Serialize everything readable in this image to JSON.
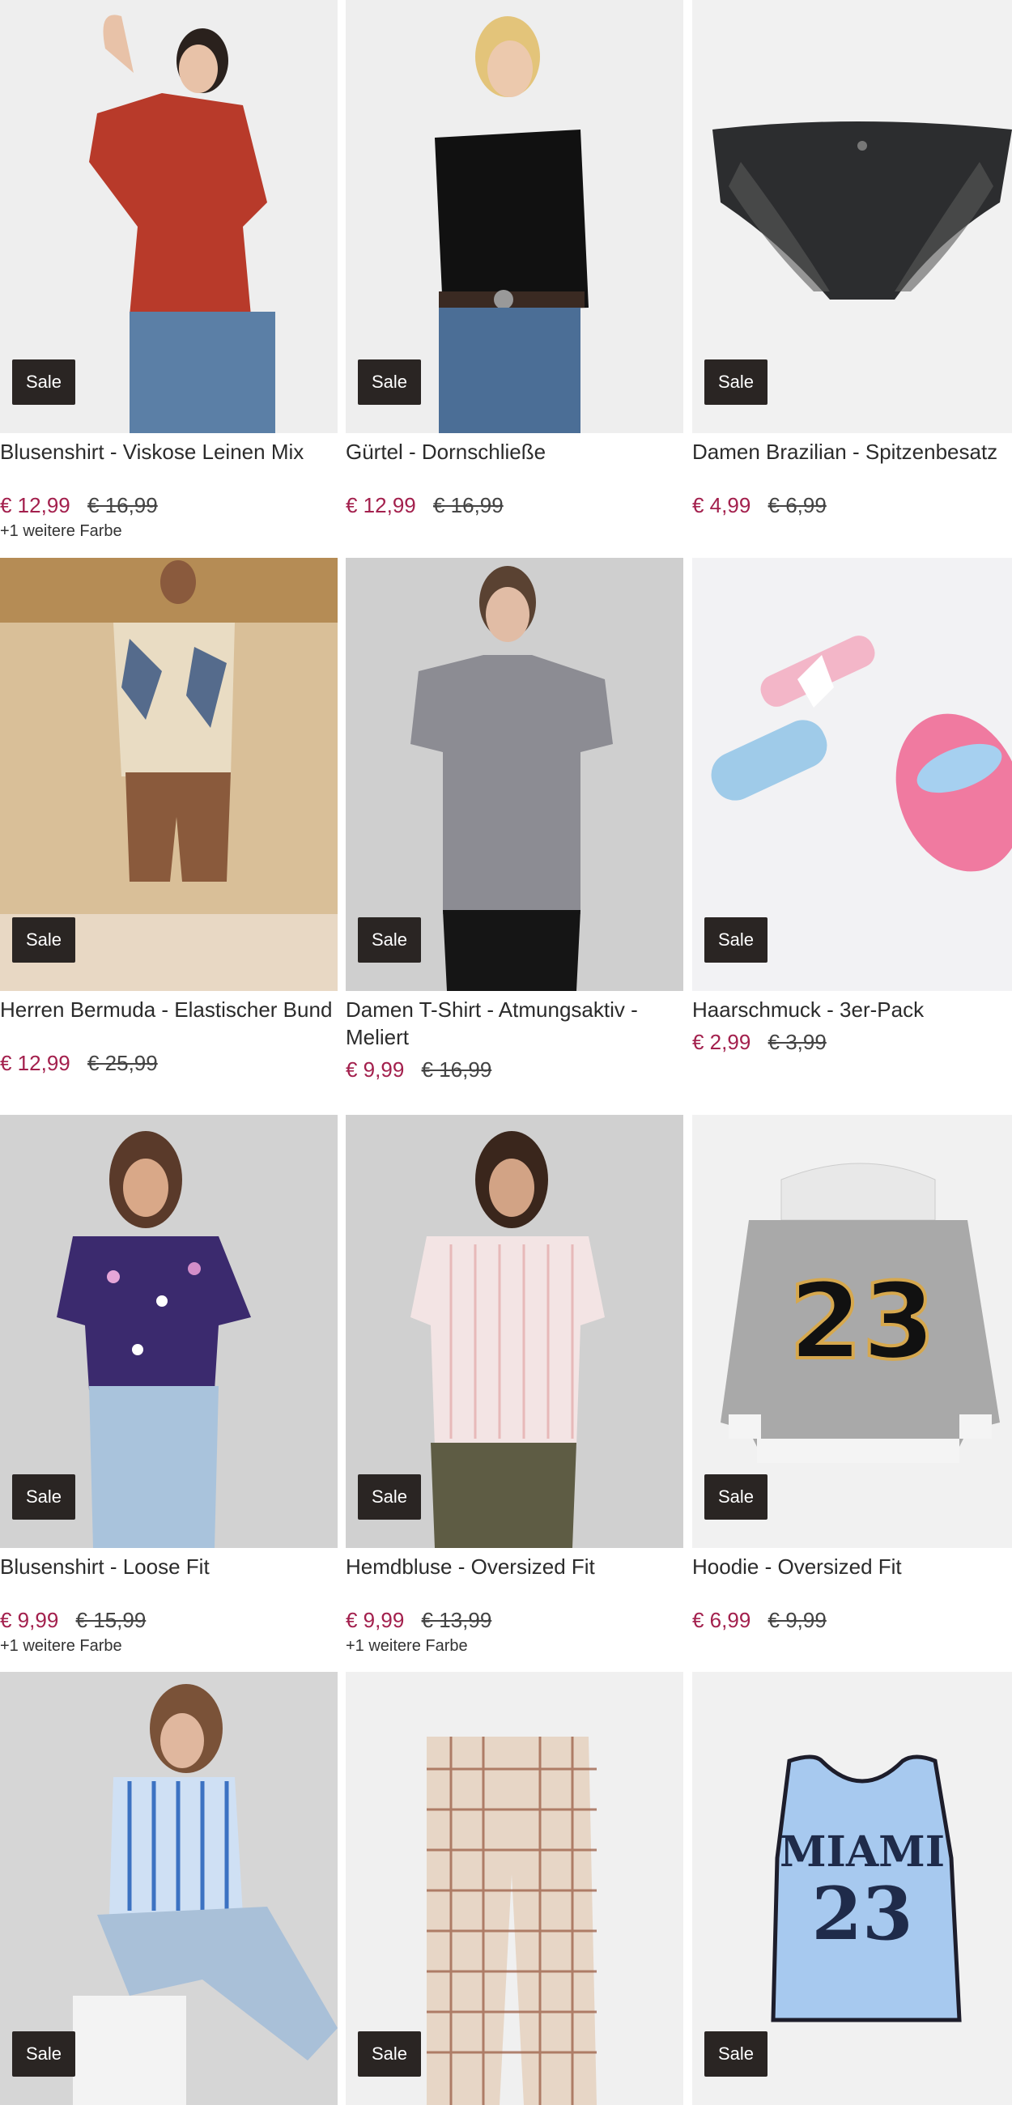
{
  "products": [
    {
      "title": "Blusenshirt - Viskose Leinen Mix",
      "price": "€ 12,99",
      "old_price": "€ 16,99",
      "extra": "+1 weitere Farbe",
      "badge": "Sale",
      "bg": "#eeeeee"
    },
    {
      "title": "Gürtel - Dornschließe",
      "price": "€ 12,99",
      "old_price": "€ 16,99",
      "extra": "",
      "badge": "Sale",
      "bg": "#eeeeee"
    },
    {
      "title": "Damen Brazilian - Spitzenbesatz",
      "price": "€ 4,99",
      "old_price": "€ 6,99",
      "extra": "",
      "badge": "Sale",
      "bg": "#f1f1f1"
    },
    {
      "title": "Herren Bermuda - Elastischer Bund",
      "price": "€ 12,99",
      "old_price": "€ 25,99",
      "extra": "",
      "badge": "Sale",
      "bg": "#d9bf98"
    },
    {
      "title": "Damen T-Shirt - Atmungsaktiv - Meliert",
      "price": "€ 9,99",
      "old_price": "€ 16,99",
      "extra": "",
      "badge": "Sale",
      "bg": "#cfcfcf"
    },
    {
      "title": "Haarschmuck - 3er-Pack",
      "price": "€ 2,99",
      "old_price": "€ 3,99",
      "extra": "",
      "badge": "Sale",
      "bg": "#f2f2f4"
    },
    {
      "title": "Blusenshirt - Loose Fit",
      "price": "€ 9,99",
      "old_price": "€ 15,99",
      "extra": "+1 weitere Farbe",
      "badge": "Sale",
      "bg": "#d2d2d2"
    },
    {
      "title": "Hemdbluse - Oversized Fit",
      "price": "€ 9,99",
      "old_price": "€ 13,99",
      "extra": "+1 weitere Farbe",
      "badge": "Sale",
      "bg": "#d0d0d0"
    },
    {
      "title": "Hoodie - Oversized Fit",
      "price": "€ 6,99",
      "old_price": "€ 9,99",
      "extra": "",
      "badge": "Sale",
      "bg": "#f1f1f1"
    },
    {
      "title": "",
      "price": "",
      "old_price": "",
      "extra": "",
      "badge": "Sale",
      "bg": "#d6d6d6"
    },
    {
      "title": "",
      "price": "",
      "old_price": "",
      "extra": "",
      "badge": "Sale",
      "bg": "#f0f0f0"
    },
    {
      "title": "",
      "price": "",
      "old_price": "",
      "extra": "",
      "badge": "Sale",
      "bg": "#f1f1f1"
    }
  ],
  "hoodie_print": "23",
  "tank_print": {
    "line1": "MIAMI",
    "line2": "23"
  }
}
